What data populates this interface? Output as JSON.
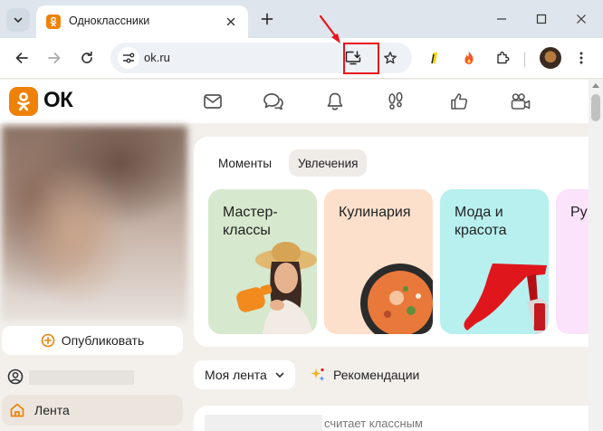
{
  "browser": {
    "tab": {
      "title": "Одноклассники"
    },
    "url": "ok.ru"
  },
  "site": {
    "logo": "ОК",
    "header_icons": [
      "mail-icon",
      "chat-icon",
      "bell-icon",
      "footprints-icon",
      "like-icon",
      "video-camera-icon"
    ],
    "sidebar": {
      "publish_label": "Опубликовать",
      "feed_label": "Лента"
    },
    "card": {
      "tabs": [
        {
          "label": "Моменты",
          "active": false
        },
        {
          "label": "Увлечения",
          "active": true
        }
      ],
      "tiles": [
        {
          "title": "Мастер-\nклассы",
          "color": "#d6e8cd"
        },
        {
          "title": "Кулинария",
          "color": "#fde0cc"
        },
        {
          "title": "Мода и\nкрасота",
          "color": "#b7f0ef"
        },
        {
          "title": "Ру",
          "color": "#fbe3fb"
        }
      ]
    },
    "feed_tabs": {
      "my_feed": "Моя лента",
      "recommendations": "Рекомендации"
    },
    "post": {
      "text": "считает классным"
    }
  },
  "colors": {
    "ok_orange": "#ee8208",
    "highlight_red": "#e8141b"
  }
}
